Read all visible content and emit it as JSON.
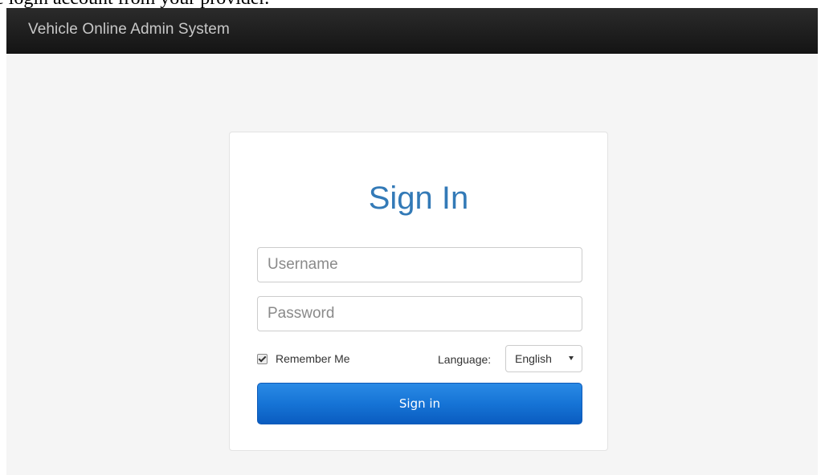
{
  "caption": "e login account from your provider.",
  "app": {
    "brand": "Vehicle Online Admin System"
  },
  "login": {
    "title": "Sign In",
    "username_placeholder": "Username",
    "password_placeholder": "Password",
    "remember_label": "Remember Me",
    "remember_checked": true,
    "language_label": "Language:",
    "language_selected": "English",
    "submit_label": "Sign in"
  },
  "colors": {
    "title": "#337ab7",
    "navbar": "#1f1f1f",
    "button": "#1674d6",
    "background": "#f5f5f5"
  },
  "icons": {
    "remember_checkbox": "checkbox-checked-icon",
    "language_caret": "caret-down-icon"
  }
}
